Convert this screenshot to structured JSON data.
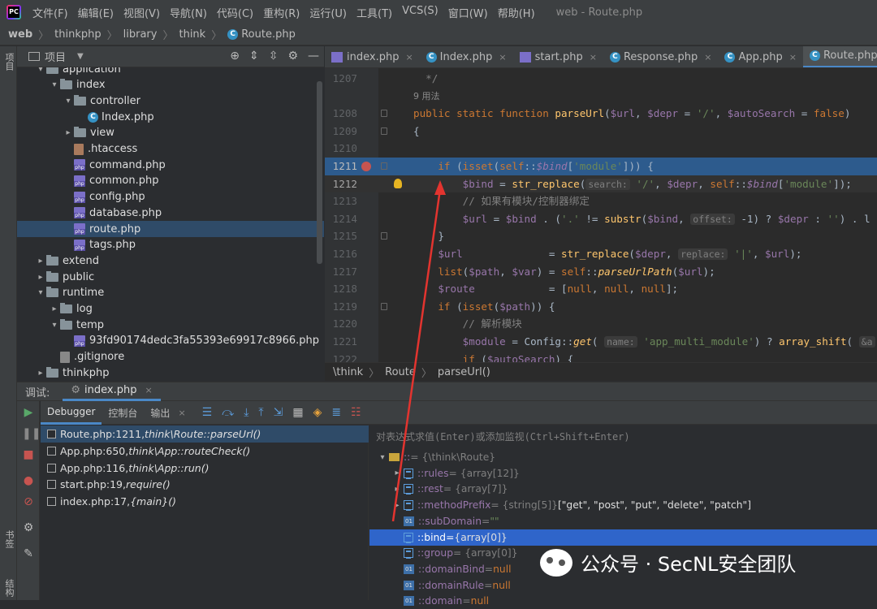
{
  "menubar": {
    "items": [
      "文件(F)",
      "编辑(E)",
      "视图(V)",
      "导航(N)",
      "代码(C)",
      "重构(R)",
      "运行(U)",
      "工具(T)",
      "VCS(S)",
      "窗口(W)",
      "帮助(H)"
    ],
    "title": "web - Route.php"
  },
  "breadcrumb": {
    "items": [
      "web",
      "thinkphp",
      "library",
      "think",
      "Route.php"
    ]
  },
  "left_strip": {
    "project": "项目",
    "bookmarks": "书签",
    "structure": "结构"
  },
  "project_panel": {
    "title": "项目"
  },
  "tree": [
    {
      "label": "application",
      "indent": 1,
      "kind": "folder",
      "arrow": "▾"
    },
    {
      "label": "index",
      "indent": 2,
      "kind": "folder",
      "arrow": "▾"
    },
    {
      "label": "controller",
      "indent": 3,
      "kind": "folder",
      "arrow": "▾"
    },
    {
      "label": "Index.php",
      "indent": 4,
      "kind": "class",
      "arrow": ""
    },
    {
      "label": "view",
      "indent": 3,
      "kind": "folder",
      "arrow": "▸"
    },
    {
      "label": ".htaccess",
      "indent": 3,
      "kind": "misc",
      "arrow": ""
    },
    {
      "label": "command.php",
      "indent": 3,
      "kind": "php",
      "arrow": ""
    },
    {
      "label": "common.php",
      "indent": 3,
      "kind": "php",
      "arrow": ""
    },
    {
      "label": "config.php",
      "indent": 3,
      "kind": "php",
      "arrow": ""
    },
    {
      "label": "database.php",
      "indent": 3,
      "kind": "php",
      "arrow": ""
    },
    {
      "label": "route.php",
      "indent": 3,
      "kind": "php",
      "arrow": "",
      "selected": true
    },
    {
      "label": "tags.php",
      "indent": 3,
      "kind": "php",
      "arrow": ""
    },
    {
      "label": "extend",
      "indent": 1,
      "kind": "folder",
      "arrow": "▸"
    },
    {
      "label": "public",
      "indent": 1,
      "kind": "folder",
      "arrow": "▸"
    },
    {
      "label": "runtime",
      "indent": 1,
      "kind": "folder",
      "arrow": "▾"
    },
    {
      "label": "log",
      "indent": 2,
      "kind": "folder",
      "arrow": "▸"
    },
    {
      "label": "temp",
      "indent": 2,
      "kind": "folder",
      "arrow": "▾"
    },
    {
      "label": "93fd90174dedc3fa55393e69917c8966.php",
      "indent": 3,
      "kind": "php",
      "arrow": ""
    },
    {
      "label": ".gitignore",
      "indent": 2,
      "kind": "git",
      "arrow": ""
    },
    {
      "label": "thinkphp",
      "indent": 1,
      "kind": "folder",
      "arrow": "▸"
    }
  ],
  "tabs": [
    {
      "label": "index.php",
      "kind": "php"
    },
    {
      "label": "Index.php",
      "kind": "class"
    },
    {
      "label": "start.php",
      "kind": "php"
    },
    {
      "label": "Response.php",
      "kind": "class"
    },
    {
      "label": "App.php",
      "kind": "class"
    },
    {
      "label": "Route.php",
      "kind": "class",
      "active": true
    }
  ],
  "editor": {
    "lines": [
      {
        "n": "1207",
        "code": "  */",
        "cls": "c"
      },
      {
        "n": "",
        "code": "9 用法",
        "cls": "usage"
      },
      {
        "n": "1208",
        "tokens": [
          [
            "public static function ",
            "k"
          ],
          [
            "parseUrl",
            "f"
          ],
          [
            "(",
            ""
          ],
          [
            "$url",
            "v"
          ],
          [
            ", ",
            ""
          ],
          [
            "$depr",
            "v"
          ],
          [
            " = ",
            ""
          ],
          [
            "'/'",
            "s"
          ],
          [
            ", ",
            ""
          ],
          [
            "$autoSearch",
            "v"
          ],
          [
            " = ",
            ""
          ],
          [
            "false",
            "k"
          ],
          [
            ")",
            ""
          ]
        ]
      },
      {
        "n": "1209",
        "code": "{",
        "cls": ""
      },
      {
        "n": "1210",
        "code": "",
        "cls": ""
      },
      {
        "n": "1211",
        "tokens": [
          [
            "    if ",
            "k"
          ],
          [
            "(",
            ""
          ],
          [
            "isset",
            "k"
          ],
          [
            "(",
            ""
          ],
          [
            "self",
            "k"
          ],
          [
            "::",
            ""
          ],
          [
            "$bind",
            "fi"
          ],
          [
            "[",
            ""
          ],
          [
            "'module'",
            "s"
          ],
          [
            "])) {",
            ""
          ]
        ],
        "highlight": true,
        "breakpoint": true
      },
      {
        "n": "1212",
        "tokens": [
          [
            "        $bind",
            "v"
          ],
          [
            " = ",
            ""
          ],
          [
            "str_replace",
            "f"
          ],
          [
            "(",
            ""
          ],
          [
            "search:",
            "hint"
          ],
          [
            " ",
            ""
          ],
          [
            "'/'",
            "s"
          ],
          [
            ", ",
            ""
          ],
          [
            "$depr",
            "v"
          ],
          [
            ", ",
            ""
          ],
          [
            "self",
            "k"
          ],
          [
            "::",
            ""
          ],
          [
            "$bind",
            "fi"
          ],
          [
            "[",
            ""
          ],
          [
            "'module'",
            "s"
          ],
          [
            "]);",
            ""
          ]
        ],
        "current": true,
        "bulb": true
      },
      {
        "n": "1213",
        "code": "        // 如果有模块/控制器绑定",
        "cls": "c"
      },
      {
        "n": "1214",
        "tokens": [
          [
            "        $url",
            "v"
          ],
          [
            " = ",
            ""
          ],
          [
            "$bind",
            "v"
          ],
          [
            " . (",
            ""
          ],
          [
            "'.'",
            "s"
          ],
          [
            " != ",
            ""
          ],
          [
            "substr",
            "f"
          ],
          [
            "(",
            ""
          ],
          [
            "$bind",
            "v"
          ],
          [
            ", ",
            ""
          ],
          [
            "offset:",
            "hint"
          ],
          [
            " -1) ? ",
            ""
          ],
          [
            "$depr",
            "v"
          ],
          [
            " : ",
            ""
          ],
          [
            "''",
            "s"
          ],
          [
            ") . l",
            ""
          ]
        ]
      },
      {
        "n": "1215",
        "code": "    }",
        "cls": ""
      },
      {
        "n": "1216",
        "tokens": [
          [
            "    $url",
            "v"
          ],
          [
            "              = ",
            ""
          ],
          [
            "str_replace",
            "f"
          ],
          [
            "(",
            ""
          ],
          [
            "$depr",
            "v"
          ],
          [
            ", ",
            ""
          ],
          [
            "replace:",
            "hint"
          ],
          [
            " ",
            ""
          ],
          [
            "'|'",
            "s"
          ],
          [
            ", ",
            ""
          ],
          [
            "$url",
            "v"
          ],
          [
            ");",
            ""
          ]
        ]
      },
      {
        "n": "1217",
        "tokens": [
          [
            "    list",
            "k"
          ],
          [
            "(",
            ""
          ],
          [
            "$path",
            "v"
          ],
          [
            ", ",
            ""
          ],
          [
            "$var",
            "v"
          ],
          [
            ") = ",
            ""
          ],
          [
            "self",
            "k"
          ],
          [
            "::",
            ""
          ],
          [
            "parseUrlPath",
            "m"
          ],
          [
            "(",
            ""
          ],
          [
            "$url",
            "v"
          ],
          [
            ");",
            ""
          ]
        ]
      },
      {
        "n": "1218",
        "tokens": [
          [
            "    $route",
            "v"
          ],
          [
            "            = [",
            ""
          ],
          [
            "null",
            "k"
          ],
          [
            ", ",
            ""
          ],
          [
            "null",
            "k"
          ],
          [
            ", ",
            ""
          ],
          [
            "null",
            "k"
          ],
          [
            "];",
            ""
          ]
        ]
      },
      {
        "n": "1219",
        "tokens": [
          [
            "    if ",
            "k"
          ],
          [
            "(",
            ""
          ],
          [
            "isset",
            "k"
          ],
          [
            "(",
            ""
          ],
          [
            "$path",
            "v"
          ],
          [
            ")) {",
            ""
          ]
        ]
      },
      {
        "n": "1220",
        "code": "        // 解析模块",
        "cls": "c"
      },
      {
        "n": "1221",
        "tokens": [
          [
            "        $module",
            "v"
          ],
          [
            " = ",
            ""
          ],
          [
            "Config",
            ""
          ],
          [
            "::",
            ""
          ],
          [
            "get",
            "m"
          ],
          [
            "( ",
            ""
          ],
          [
            "name:",
            "hint"
          ],
          [
            " ",
            ""
          ],
          [
            "'app_multi_module'",
            "s"
          ],
          [
            ") ? ",
            ""
          ],
          [
            "array_shift",
            "f"
          ],
          [
            "( ",
            ""
          ],
          [
            "&a",
            "hint"
          ]
        ]
      },
      {
        "n": "1222",
        "tokens": [
          [
            "        if ",
            "k"
          ],
          [
            "(",
            ""
          ],
          [
            "$autoSearch",
            "v"
          ],
          [
            ") {",
            ""
          ]
        ]
      }
    ]
  },
  "editor_breadcrumb": {
    "items": [
      "\\think",
      "Route",
      "parseUrl()"
    ]
  },
  "debug": {
    "label": "调试:",
    "session": "index.php",
    "tabs": [
      "Debugger",
      "控制台",
      "输出"
    ],
    "frames": [
      {
        "loc": "Route.php:1211, ",
        "fn": "think\\Route::parseUrl()",
        "selected": true
      },
      {
        "loc": "App.php:650, ",
        "fn": "think\\App::routeCheck()"
      },
      {
        "loc": "App.php:116, ",
        "fn": "think\\App::run()"
      },
      {
        "loc": "start.php:19, ",
        "fn": "require()"
      },
      {
        "loc": "index.php:17, ",
        "fn": "{main}()"
      }
    ],
    "eval_placeholder": "对表达式求值(Enter)或添加监视(Ctrl+Shift+Enter)",
    "vars": [
      {
        "arrow": "▾",
        "icon": "obj",
        "name": ":: ",
        "type": "= {\\think\\Route}",
        "val": "",
        "indent": 0
      },
      {
        "arrow": "▸",
        "icon": "list",
        "name": "::rules",
        "type": " = {array[12]}",
        "val": "",
        "indent": 1
      },
      {
        "arrow": "▸",
        "icon": "list",
        "name": "::rest",
        "type": " = {array[7]}",
        "val": "",
        "indent": 1
      },
      {
        "arrow": "▸",
        "icon": "list",
        "name": "::methodPrefix",
        "type": " = {string[5]} ",
        "val": "[\"get\", \"post\", \"put\", \"delete\", \"patch\"]",
        "indent": 1
      },
      {
        "arrow": "",
        "icon": "01",
        "name": "::subDomain",
        "type": " = ",
        "str": "\"\"",
        "indent": 1
      },
      {
        "arrow": "",
        "icon": "list",
        "name": "::bind",
        "type": " = ",
        "val": "{array[0]}",
        "indent": 1,
        "selected": true
      },
      {
        "arrow": "",
        "icon": "list",
        "name": "::group",
        "type": " = {array[0]}",
        "val": "",
        "indent": 1
      },
      {
        "arrow": "",
        "icon": "01",
        "name": "::domainBind",
        "type": " = ",
        "null": "null",
        "indent": 1
      },
      {
        "arrow": "",
        "icon": "01",
        "name": "::domainRule",
        "type": " = ",
        "null": "null",
        "indent": 1
      },
      {
        "arrow": "",
        "icon": "01",
        "name": "::domain",
        "type": " = ",
        "null": "null",
        "indent": 1
      }
    ]
  },
  "watermark": {
    "text": "公众号 · SecNL安全团队"
  }
}
